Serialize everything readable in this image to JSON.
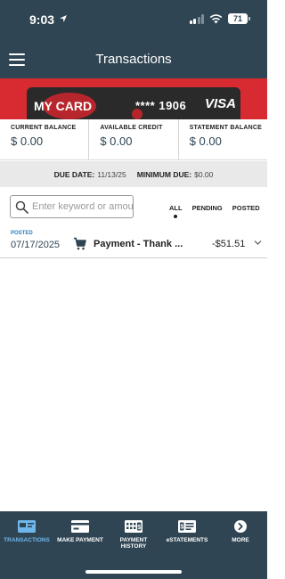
{
  "status_bar": {
    "time": "9:03",
    "battery": "71"
  },
  "header": {
    "title": "Transactions"
  },
  "card": {
    "name": "MY CARD",
    "number": "**** 1906",
    "brand": "VISA"
  },
  "balances": [
    {
      "label": "CURRENT BALANCE",
      "value": "$ 0.00"
    },
    {
      "label": "AVAILABLE CREDIT",
      "value": "$ 0.00"
    },
    {
      "label": "STATEMENT BALANCE",
      "value": "$ 0.00"
    }
  ],
  "due": {
    "due_date_label": "DUE DATE:",
    "due_date_value": "11/13/25",
    "minimum_due_label": "MINIMUM DUE:",
    "minimum_due_value": "$0.00"
  },
  "search": {
    "placeholder": "Enter keyword or amount"
  },
  "filters": [
    "ALL",
    "PENDING",
    "POSTED"
  ],
  "transactions": [
    {
      "status": "POSTED",
      "date": "07/17/2025",
      "description": "Payment - Thank ...",
      "amount": "-$51.51"
    }
  ],
  "bottom_nav": [
    {
      "label": "TRANSACTIONS",
      "icon": "card-list-icon"
    },
    {
      "label": "MAKE PAYMENT",
      "icon": "card-icon"
    },
    {
      "label": "PAYMENT\nHISTORY",
      "icon": "calendar-icon"
    },
    {
      "label": "eSTATEMENTS",
      "icon": "statement-icon"
    },
    {
      "label": "MORE",
      "icon": "chevron-circle-icon"
    }
  ],
  "colors": {
    "navy": "#2f4553",
    "red": "#d72b31",
    "link_blue": "#2a7fbf",
    "active_blue": "#6fb6ea"
  }
}
